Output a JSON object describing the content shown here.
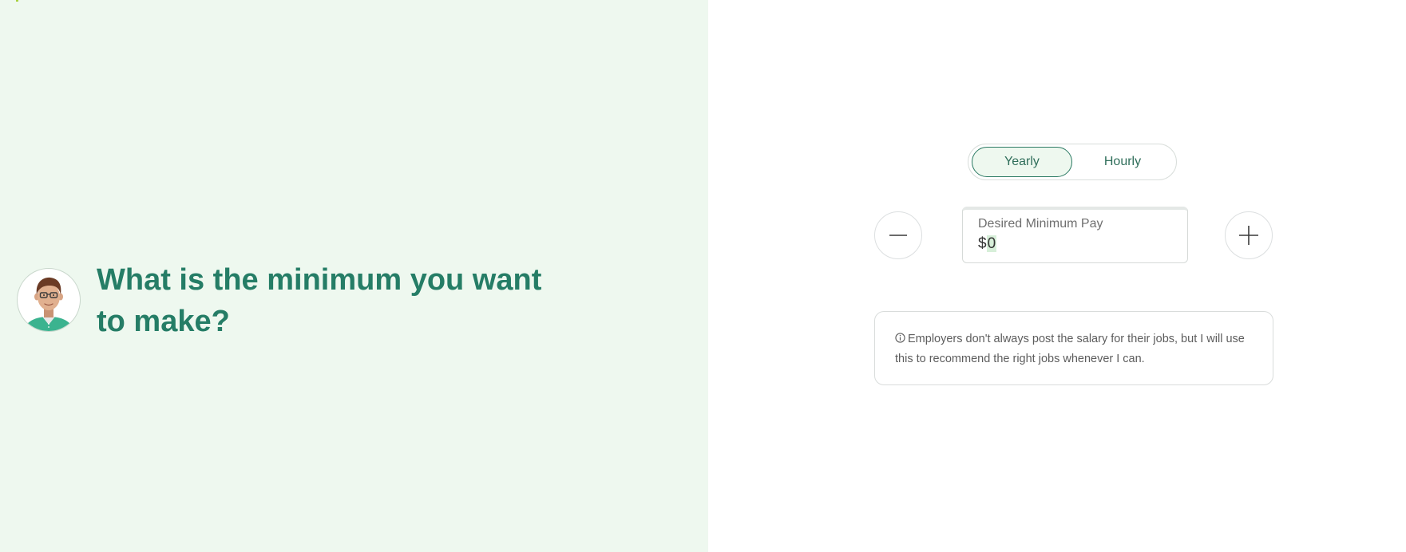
{
  "question": {
    "text": "What is the minimum you want to make?"
  },
  "avatar": {
    "icon": "person-avatar"
  },
  "pay_type_toggle": {
    "options": [
      {
        "label": "Yearly",
        "active": true
      },
      {
        "label": "Hourly",
        "active": false
      }
    ]
  },
  "pay_field": {
    "label": "Desired Minimum Pay",
    "currency": "$",
    "value": "0"
  },
  "buttons": {
    "decrement_icon": "minus-icon",
    "increment_icon": "plus-icon"
  },
  "info": {
    "icon": "info-icon",
    "text": "Employers don't always post the salary for their jobs, but I will use this to recommend the right jobs whenever I can."
  },
  "colors": {
    "left_background": "#eef8ef",
    "accent": "#257d66",
    "value_highlight": "#d7efd9"
  }
}
